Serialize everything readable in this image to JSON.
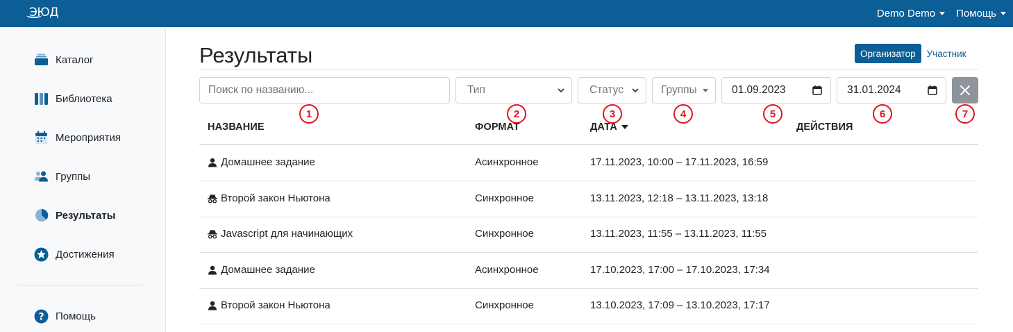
{
  "navbar": {
    "logo": "ЭЮД",
    "user_menu": "Demo Demo",
    "help_menu": "Помощь"
  },
  "sidebar": {
    "items": [
      {
        "label": "Каталог",
        "icon": "catalog-icon"
      },
      {
        "label": "Библиотека",
        "icon": "library-icon"
      },
      {
        "label": "Мероприятия",
        "icon": "calendar-icon"
      },
      {
        "label": "Группы",
        "icon": "users-icon"
      },
      {
        "label": "Результаты",
        "icon": "pie-chart-icon",
        "active": true
      },
      {
        "label": "Достижения",
        "icon": "star-icon"
      },
      {
        "label": "Помощь",
        "icon": "question-icon"
      }
    ]
  },
  "page": {
    "title": "Результаты",
    "roles": {
      "organizer": "Организатор",
      "participant": "Участник",
      "active": "organizer"
    }
  },
  "filters": {
    "search_placeholder": "Поиск по названию...",
    "type": "Тип",
    "status": "Статус",
    "groups": "Группы",
    "date_from": "01.09.2023",
    "date_to": "31.01.2024"
  },
  "markers": [
    "1",
    "2",
    "3",
    "4",
    "5",
    "6",
    "7"
  ],
  "table": {
    "headers": {
      "name": "НАЗВАНИЕ",
      "format": "ФОРМАТ",
      "date": "ДАТА",
      "actions": "ДЕЙСТВИЯ"
    },
    "rows": [
      {
        "icon": "person-icon",
        "name": "Домашнее задание",
        "format": "Асинхронное",
        "date": "17.11.2023, 10:00 – 17.11.2023, 16:59"
      },
      {
        "icon": "incognito-icon",
        "name": "Второй закон Ньютона",
        "format": "Синхронное",
        "date": "13.11.2023, 12:18 – 13.11.2023, 13:18"
      },
      {
        "icon": "incognito-icon",
        "name": "Javascript для начинающих",
        "format": "Синхронное",
        "date": "13.11.2023, 11:55 – 13.11.2023, 11:55"
      },
      {
        "icon": "person-icon",
        "name": "Домашнее задание",
        "format": "Асинхронное",
        "date": "17.10.2023, 17:00 – 17.10.2023, 17:34"
      },
      {
        "icon": "person-icon",
        "name": "Второй закон Ньютона",
        "format": "Синхронное",
        "date": "13.10.2023, 17:09 – 13.10.2023, 17:17"
      }
    ]
  },
  "colors": {
    "primary": "#0c5e96",
    "marker": "#e0141e",
    "clear_button": "#8e9499"
  }
}
